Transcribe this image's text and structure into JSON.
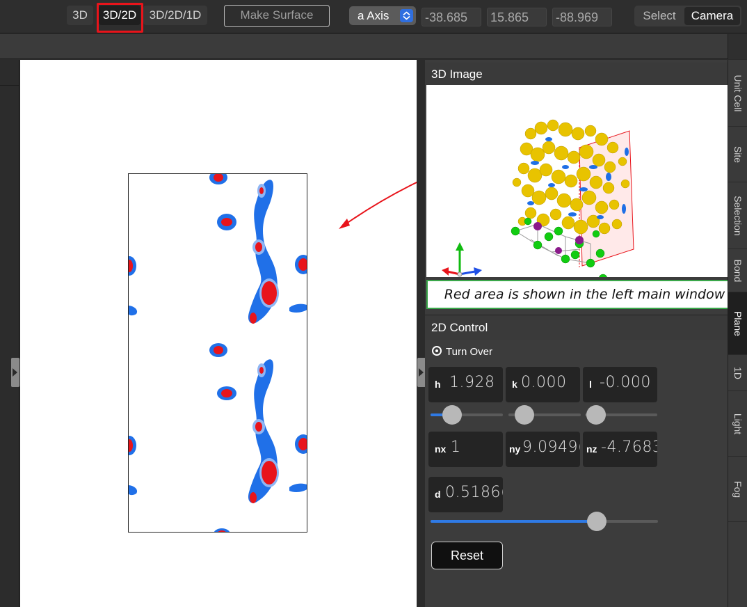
{
  "toolbar": {
    "mode_3d": "3D",
    "mode_3d2d": "3D/2D",
    "mode_3d2d1d": "3D/2D/1D",
    "make_surface": "Make Surface",
    "axis": "a Axis",
    "coord_x": "-38.685",
    "coord_y": "15.865",
    "coord_z": "-88.969",
    "select": "Select",
    "camera": "Camera"
  },
  "panel_3d": {
    "title": "3D Image",
    "annotation": "Red area is shown in the left main window"
  },
  "panel_2d": {
    "title": "2D Control",
    "turn_over": "Turn Over",
    "fields": {
      "h": {
        "label": "h",
        "value": "1.928",
        "slider": 0.3
      },
      "k": {
        "label": "k",
        "value": "0.000",
        "slider": 0.22
      },
      "l": {
        "label": "l",
        "value": "-0.000",
        "slider": 0.15
      },
      "nx": {
        "label": "nx",
        "value": "1"
      },
      "ny": {
        "label": "ny",
        "value": "9.0949("
      },
      "nz": {
        "label": "nz",
        "value": "-4.7683"
      },
      "d": {
        "label": "d",
        "value": "0.5186(",
        "slider": 0.73
      }
    },
    "reset": "Reset"
  },
  "side_tabs": [
    "Unit Cell",
    "Site",
    "Selection",
    "Bond",
    "Plane",
    "1D",
    "Light",
    "Fog"
  ],
  "active_tab": "Plane",
  "colors": {
    "accent_blue": "#2f7ae5",
    "highlight_red": "#e8141b",
    "annotation_green": "#3aa74a",
    "contour_blue": "#1f6fe6",
    "contour_red": "#e8141b",
    "atom_yellow": "#e8c300",
    "atom_green": "#11cc11",
    "atom_purple": "#8a1a8a"
  }
}
